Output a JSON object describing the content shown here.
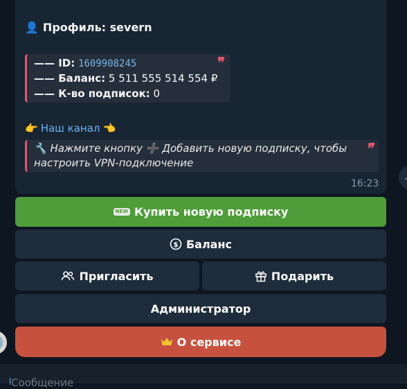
{
  "message": {
    "profile_icon": "👤",
    "profile_text": "Профиль: severn",
    "info": {
      "id_label": "—— ID:",
      "id_value": "1609908245",
      "balance_label": "—— Баланс:",
      "balance_value": "5 511 555 514 554 ₽",
      "subs_label": "—— К-во подписок:",
      "subs_value": "0",
      "quote_mark": "❞"
    },
    "channel": {
      "left_emoji": "👉",
      "link_text": "Наш канал",
      "right_emoji": "👈"
    },
    "hint": {
      "text": "🔧 Нажмите кнопку ➕ Добавить новую подписку, чтобы настроить VPN-подключение",
      "quote_mark": "❞"
    },
    "time": "16:23"
  },
  "buttons": {
    "buy": {
      "badge": "NEW",
      "label": "Купить новую подписку",
      "color": "#4e9d3a"
    },
    "balance": {
      "icon": "coin-icon",
      "label": "Баланс"
    },
    "invite": {
      "icon": "users-icon",
      "label": "Пригласить"
    },
    "gift": {
      "icon": "gift-icon",
      "label": "Подарить"
    },
    "admin": {
      "label": "Администратор"
    },
    "about": {
      "icon": "crown-icon",
      "label": "О сервисе",
      "color": "#c7513f"
    }
  },
  "compose": {
    "placeholder": "Сообщение"
  },
  "colors": {
    "background": "#0e1621",
    "bubble": "#182533",
    "quote_accent": "#e5566b",
    "link": "#6ab3f3"
  }
}
